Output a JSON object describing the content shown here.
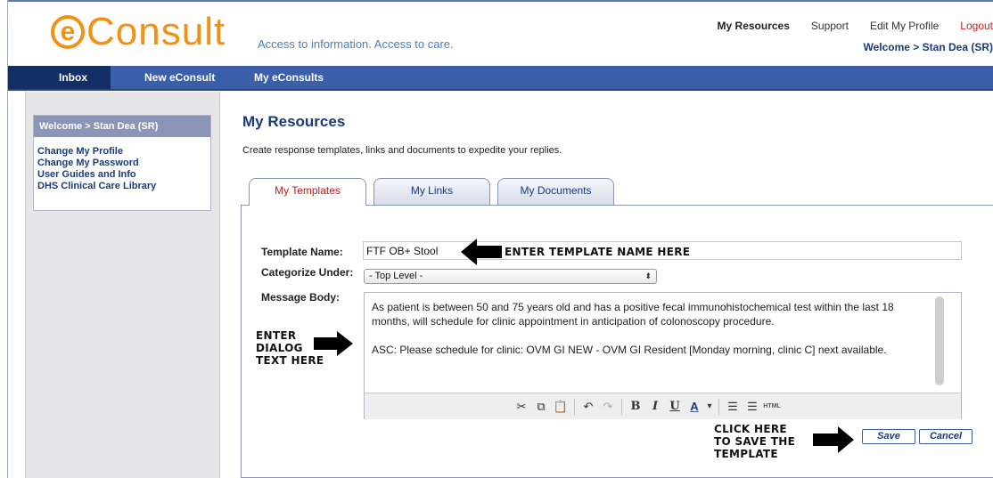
{
  "header": {
    "logo_mark": "e",
    "logo_text": "Consult",
    "tagline": "Access to information. Access to care.",
    "links": {
      "resources": "My Resources",
      "support": "Support",
      "edit_profile": "Edit My Profile",
      "logout": "Logout"
    },
    "welcome": "Welcome > Stan Dea (SR)"
  },
  "nav": {
    "inbox": "Inbox",
    "new_econsult": "New eConsult",
    "my_econsults": "My eConsults"
  },
  "sidebar": {
    "heading": "Welcome > Stan Dea (SR)",
    "links": [
      "Change My Profile",
      "Change My Password",
      "User Guides and Info",
      "DHS Clinical Care Library"
    ]
  },
  "main": {
    "title": "My Resources",
    "description": "Create response templates, links and documents to expedite your replies.",
    "tabs": {
      "templates": "My Templates",
      "links": "My Links",
      "documents": "My Documents"
    }
  },
  "form": {
    "template_name_label": "Template Name:",
    "template_name_value": "FTF OB+ Stool",
    "category_label": "Categorize Under:",
    "category_value": "- Top Level -",
    "message_label": "Message Body:",
    "message_paragraphs": [
      "As patient is between 50 and 75 years old and has a positive fecal immunohistochemical test within the last 18 months, will schedule for clinic appointment in anticipation of colonoscopy procedure.",
      "ASC: Please schedule for clinic: OVM GI NEW - OVM GI Resident [Monday morning, clinic C] next available."
    ],
    "toolbar": {
      "cut": "✂",
      "copy": "⧉",
      "paste": "📋",
      "undo": "↶",
      "redo": "↷",
      "bold": "B",
      "italic": "I",
      "underline": "U",
      "font_color": "A",
      "font_color_dropdown": "▾",
      "bullet_list": "☰",
      "numbered_list": "☰",
      "html": "HTML"
    },
    "save_label": "Save",
    "cancel_label": "Cancel"
  },
  "annotations": {
    "enter_name": "ENTER TEMPLATE NAME HERE",
    "enter_dialog": [
      "ENTER",
      "DIALOG",
      "TEXT HERE"
    ],
    "click_save": [
      "CLICK HERE",
      "TO SAVE THE",
      "TEMPLATE"
    ]
  },
  "colors": {
    "brand_orange": "#f29112",
    "nav_blue": "#3a5fa8",
    "nav_active": "#142e66",
    "title_blue": "#1a3a7a",
    "active_tab_red": "#b52020"
  }
}
